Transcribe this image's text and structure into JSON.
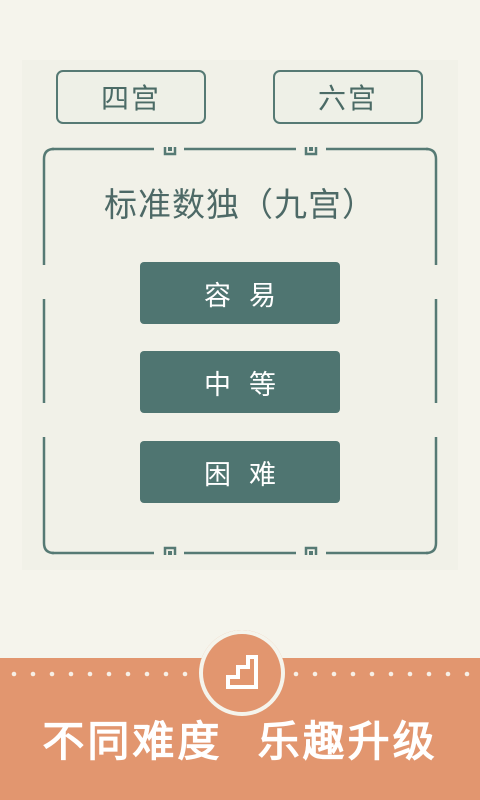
{
  "mode_tabs": {
    "four_grid": "四宫",
    "six_grid": "六宫"
  },
  "standard": {
    "title": "标准数独（九宫）",
    "levels": {
      "easy": "容易",
      "medium": "中等",
      "hard": "困难"
    }
  },
  "banner": {
    "slogan": "不同难度  乐趣升级",
    "icon": "stairs-icon"
  },
  "colors": {
    "accent_teal": "#4f7571",
    "banner_orange": "#e2966f",
    "background": "#f5f4ec"
  }
}
